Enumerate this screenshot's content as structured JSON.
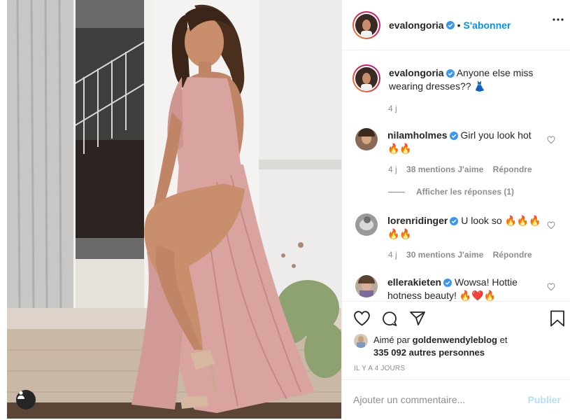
{
  "post": {
    "image_alt": "",
    "tag_icon": "user-tag-icon"
  },
  "header": {
    "username": "evalongoria",
    "dot": "•",
    "follow_label": "S'abonner",
    "more_icon": "more-options-icon"
  },
  "caption": {
    "username": "evalongoria",
    "text": "Anyone else miss wearing dresses?? 👗",
    "time": "4 j"
  },
  "comments": [
    {
      "username": "nilamholmes",
      "text": "Girl you look hot 🔥🔥",
      "time": "4 j",
      "likes": "38 mentions J'aime",
      "reply_label": "Répondre",
      "view_replies": "Afficher les réponses (1)"
    },
    {
      "username": "lorenridinger",
      "text": "U look so 🔥🔥🔥 🔥🔥",
      "time": "4 j",
      "likes": "30 mentions J'aime",
      "reply_label": "Répondre"
    },
    {
      "username": "ellerakieten",
      "text": "Wowsa! Hottie hotness beauty! 🔥❤️🔥"
    }
  ],
  "actions": {
    "like_icon": "heart-icon",
    "comment_icon": "comment-icon",
    "share_icon": "share-icon",
    "save_icon": "bookmark-icon"
  },
  "likes": {
    "prefix": "Aimé par",
    "user": "goldenwendyleblog",
    "conj": "et",
    "count": "335 092 autres personnes"
  },
  "age": "IL Y A 4 JOURS",
  "add_comment": {
    "placeholder": "Ajouter un commentaire...",
    "publish_label": "Publier"
  },
  "colors": {
    "accent": "#0095f6",
    "publish_disabled": "#b2dffc",
    "verified": "#3897f0",
    "text": "#262626",
    "muted": "#8e8e8e",
    "border": "#efefef",
    "dress": "#d9a4a0"
  }
}
